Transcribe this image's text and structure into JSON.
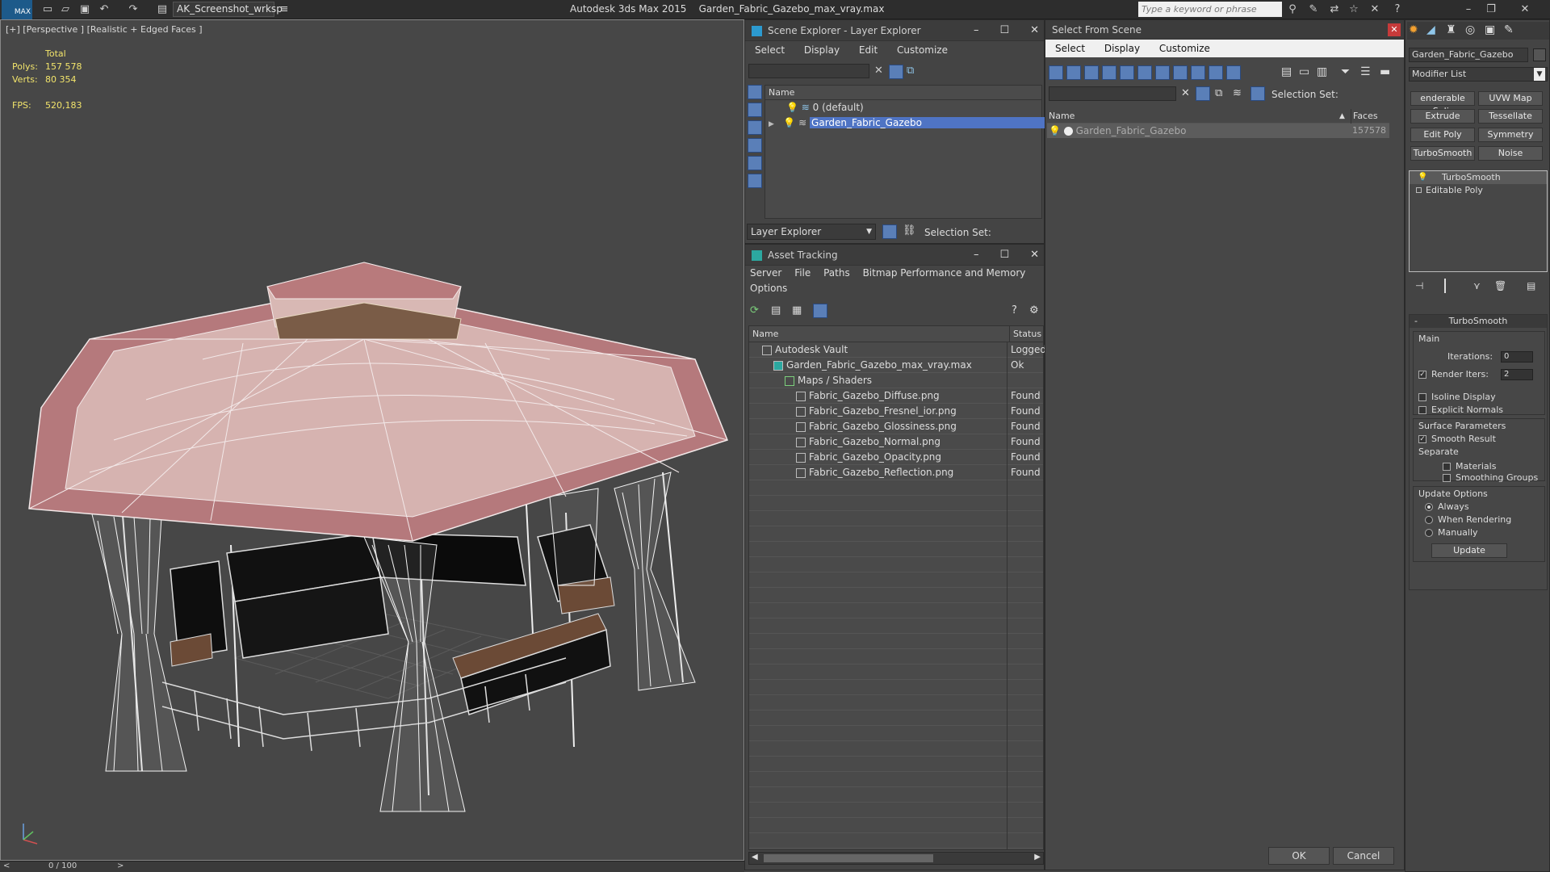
{
  "app": {
    "title": "Autodesk 3ds Max  2015",
    "file": "Garden_Fabric_Gazebo_max_vray.max",
    "workspace": "AK_Screenshot_wrksp",
    "search_placeholder": "Type a keyword or phrase",
    "logo": "MAX"
  },
  "viewport": {
    "label": "[+] [Perspective ] [Realistic + Edged Faces ]",
    "stats": {
      "total_label": "Total",
      "polys_label": "Polys:",
      "polys_value": "157 578",
      "verts_label": "Verts:",
      "verts_value": "80 354",
      "fps_label": "FPS:",
      "fps_value": "520,183"
    }
  },
  "timeline": {
    "value": "0 / 100"
  },
  "scene_explorer": {
    "title": "Scene Explorer - Layer Explorer",
    "menu": [
      "Select",
      "Display",
      "Edit",
      "Customize"
    ],
    "column": "Name",
    "rows": [
      {
        "name": "0 (default)"
      },
      {
        "name": "Garden_Fabric_Gazebo"
      }
    ],
    "footer_dropdown": "Layer Explorer",
    "selection_set_label": "Selection Set:"
  },
  "asset_tracking": {
    "title": "Asset Tracking",
    "menu": [
      "Server",
      "File",
      "Paths",
      "Bitmap Performance and Memory"
    ],
    "menu2": [
      "Options"
    ],
    "col_name": "Name",
    "col_status": "Status",
    "rows": [
      {
        "name": "Autodesk Vault",
        "status": "Logged",
        "indent": 0
      },
      {
        "name": "Garden_Fabric_Gazebo_max_vray.max",
        "status": "Ok",
        "indent": 1
      },
      {
        "name": "Maps / Shaders",
        "status": "",
        "indent": 2
      },
      {
        "name": "Fabric_Gazebo_Diffuse.png",
        "status": "Found",
        "indent": 3
      },
      {
        "name": "Fabric_Gazebo_Fresnel_ior.png",
        "status": "Found",
        "indent": 3
      },
      {
        "name": "Fabric_Gazebo_Glossiness.png",
        "status": "Found",
        "indent": 3
      },
      {
        "name": "Fabric_Gazebo_Normal.png",
        "status": "Found",
        "indent": 3
      },
      {
        "name": "Fabric_Gazebo_Opacity.png",
        "status": "Found",
        "indent": 3
      },
      {
        "name": "Fabric_Gazebo_Reflection.png",
        "status": "Found",
        "indent": 3
      }
    ]
  },
  "select_from_scene": {
    "title": "Select From Scene",
    "menu": [
      "Select",
      "Display",
      "Customize"
    ],
    "selection_set_label": "Selection Set:",
    "col_name": "Name",
    "col_faces": "Faces",
    "rows": [
      {
        "name": "Garden_Fabric_Gazebo",
        "faces": "157578"
      }
    ],
    "ok": "OK",
    "cancel": "Cancel"
  },
  "command_panel": {
    "object_name": "Garden_Fabric_Gazebo",
    "modifier_list": "Modifier List",
    "buttons": [
      "enderable Splir",
      "UVW Map",
      "Extrude",
      "Tessellate",
      "Edit Poly",
      "Symmetry",
      "TurboSmooth",
      "Noise"
    ],
    "stack": [
      "TurboSmooth",
      "Editable Poly"
    ],
    "rollout_title": "TurboSmooth",
    "main_label": "Main",
    "iterations_label": "Iterations:",
    "iterations_value": "0",
    "render_iters_label": "Render Iters:",
    "render_iters_value": "2",
    "isoline": "Isoline Display",
    "explicit_normals": "Explicit Normals",
    "surface_params": "Surface Parameters",
    "smooth_result": "Smooth Result",
    "separate": "Separate",
    "materials": "Materials",
    "smoothing_groups": "Smoothing Groups",
    "update_options": "Update Options",
    "always": "Always",
    "when_rendering": "When Rendering",
    "manually": "Manually",
    "update": "Update"
  }
}
